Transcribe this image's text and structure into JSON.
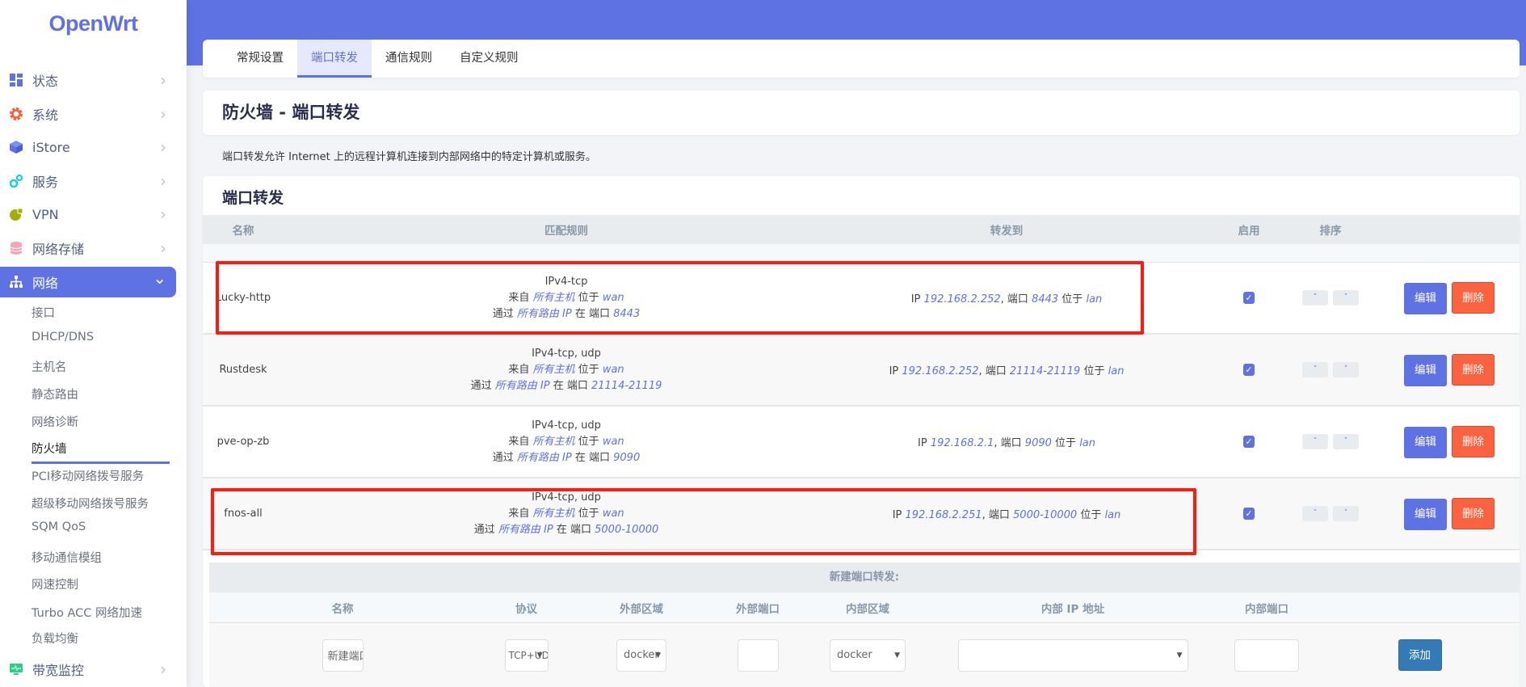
{
  "brand": "OpenWrt",
  "colors": {
    "accent": "#5e72e4",
    "delete": "#fb6340",
    "add": "#337ab7",
    "highlight": "#ff1a0f"
  },
  "sidebar": {
    "items": [
      {
        "label": "状态",
        "icon": "dashboard-icon"
      },
      {
        "label": "系统",
        "icon": "gear-icon"
      },
      {
        "label": "iStore",
        "icon": "cube-icon"
      },
      {
        "label": "服务",
        "icon": "cogs-icon"
      },
      {
        "label": "VPN",
        "icon": "globe-lock-icon"
      },
      {
        "label": "网络存储",
        "icon": "database-icon"
      },
      {
        "label": "网络",
        "icon": "sitemap-icon",
        "active": true
      },
      {
        "label": "带宽监控",
        "icon": "monitor-icon"
      }
    ],
    "network_sub": [
      "接口",
      "DHCP/DNS",
      "主机名",
      "静态路由",
      "网络诊断",
      "防火墙",
      "PCI移动网络拨号服务",
      "超级移动网络拨号服务",
      "SQM QoS",
      "移动通信模组",
      "网速控制",
      "Turbo ACC 网络加速",
      "负载均衡"
    ],
    "current_sub": "防火墙"
  },
  "tabs": [
    "常规设置",
    "端口转发",
    "通信规则",
    "自定义规则"
  ],
  "active_tab": "端口转发",
  "page_title": "防火墙 - 端口转发",
  "description": "端口转发允许 Internet 上的远程计算机连接到内部网络中的特定计算机或服务。",
  "section_title": "端口转发",
  "table": {
    "headers": [
      "名称",
      "匹配规则",
      "转发到",
      "启用",
      "排序"
    ],
    "words": {
      "from": "来自",
      "located": "位于",
      "via": "通过",
      "at_port": "在 端口",
      "ip": "IP",
      ",port": ", 端口"
    },
    "rows": [
      {
        "name": "Lucky-http",
        "proto": "IPv4-tcp",
        "src": "所有主机",
        "src_zone": "wan",
        "dest": "所有路由 IP",
        "ext_port": "8443",
        "fwd_ip": "192.168.2.252",
        "fwd_port": "8443",
        "fwd_zone": "lan",
        "enabled": true,
        "highlighted": true
      },
      {
        "name": "Rustdesk",
        "proto": "IPv4-tcp, udp",
        "src": "所有主机",
        "src_zone": "wan",
        "dest": "所有路由 IP",
        "ext_port": "21114-21119",
        "fwd_ip": "192.168.2.252",
        "fwd_port": "21114-21119",
        "fwd_zone": "lan",
        "enabled": true,
        "highlighted": false
      },
      {
        "name": "pve-op-zb",
        "proto": "IPv4-tcp, udp",
        "src": "所有主机",
        "src_zone": "wan",
        "dest": "所有路由 IP",
        "ext_port": "9090",
        "fwd_ip": "192.168.2.1",
        "fwd_port": "9090",
        "fwd_zone": "lan",
        "enabled": true,
        "highlighted": false
      },
      {
        "name": "fnos-all",
        "proto": "IPv4-tcp, udp",
        "src": "所有主机",
        "src_zone": "wan",
        "dest": "所有路由 IP",
        "ext_port": "5000-10000",
        "fwd_ip": "192.168.2.251",
        "fwd_port": "5000-10000",
        "fwd_zone": "lan",
        "enabled": true,
        "highlighted": true
      }
    ],
    "sort_up": "˄",
    "sort_down": "˅",
    "edit_label": "编辑",
    "delete_label": "删除"
  },
  "new_form": {
    "title": "新建端口转发:",
    "headers": [
      "名称",
      "协议",
      "外部区域",
      "外部端口",
      "内部区域",
      "内部 IP 地址",
      "内部端口"
    ],
    "name_placeholder": "新建端口转发",
    "protocol": "TCP+UDP",
    "ext_zone": "docker",
    "ext_port": "",
    "int_zone": "docker",
    "int_ip": "",
    "int_port": "",
    "add_label": "添加"
  }
}
